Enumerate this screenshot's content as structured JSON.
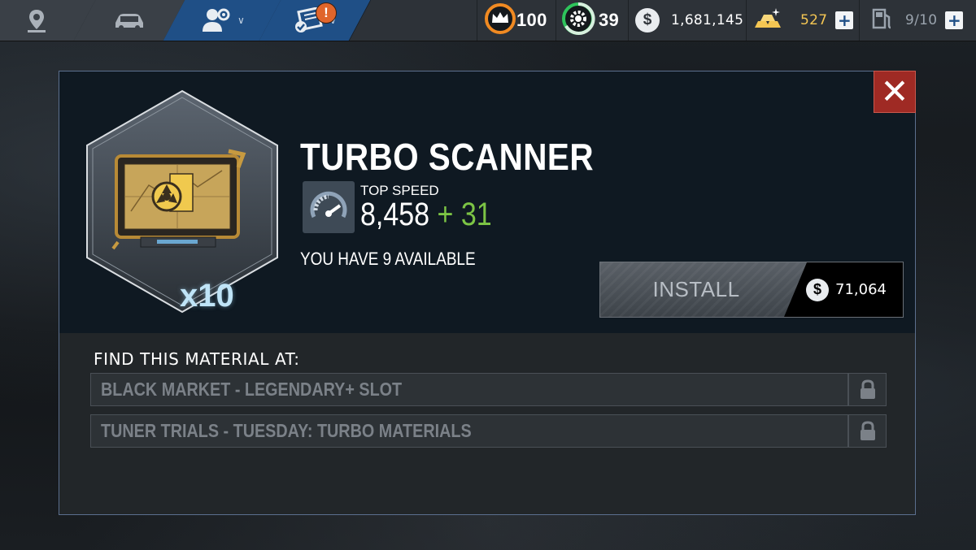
{
  "nav": {
    "items": [
      {
        "name": "map",
        "icon": "location-pin-icon"
      },
      {
        "name": "garage",
        "icon": "car-icon"
      },
      {
        "name": "crew",
        "icon": "crew-settings-icon",
        "active": true
      },
      {
        "name": "tasks",
        "icon": "task-list-icon",
        "active": true,
        "alert": "!"
      }
    ]
  },
  "resources": {
    "rep": "100",
    "level": "39",
    "cash": "1,681,145",
    "gold": "527",
    "fuel": "9/10"
  },
  "modal": {
    "close_label": "✕",
    "item": {
      "title": "TURBO SCANNER",
      "quantity": "x10",
      "stat_label": "TOP SPEED",
      "stat_value": "8,458",
      "stat_plus": "+",
      "stat_bonus": "31",
      "available_text": "YOU HAVE 9 AVAILABLE"
    },
    "install": {
      "label": "INSTALL",
      "currency_symbol": "$",
      "price": "71,064"
    },
    "find": {
      "heading": "FIND THIS MATERIAL AT:",
      "sources": [
        {
          "label": "BLACK MARKET - LEGENDARY+ SLOT",
          "locked": true
        },
        {
          "label": "TUNER TRIALS - TUESDAY: TURBO MATERIALS",
          "locked": true
        }
      ]
    }
  },
  "colors": {
    "accent_blue": "#1f4f86",
    "close_red": "#9f2a24",
    "bonus_green": "#7cc445",
    "gold": "#f4c653",
    "modal_border": "#5b6f8e"
  }
}
